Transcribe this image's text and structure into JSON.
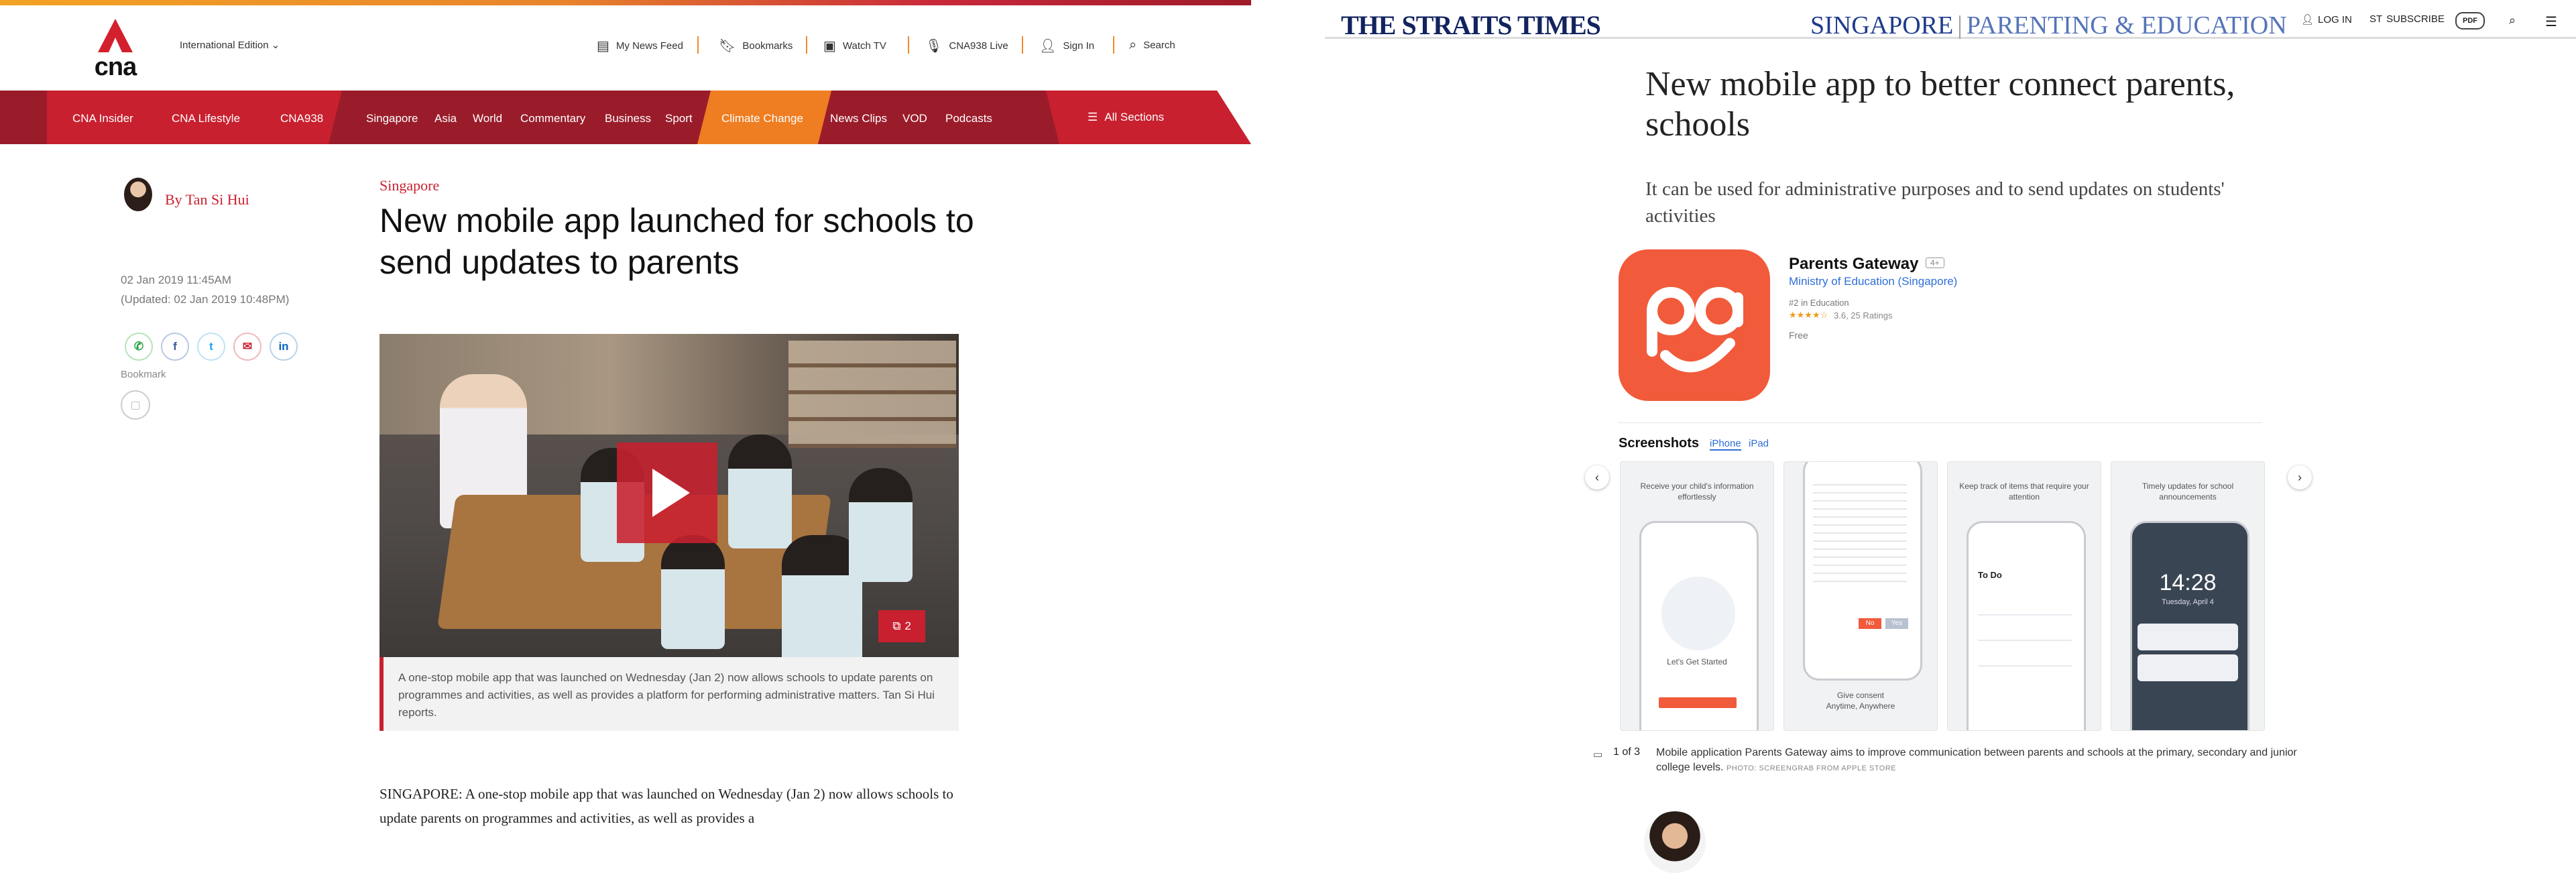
{
  "cna": {
    "logo_text": "cna",
    "edition": "International Edition",
    "utility": [
      {
        "label": "My News Feed",
        "icon": "newsfeed-icon"
      },
      {
        "label": "Bookmarks",
        "icon": "bookmark-icon"
      },
      {
        "label": "Watch TV",
        "icon": "tv-icon"
      },
      {
        "label": "CNA938 Live",
        "icon": "microphone-icon"
      },
      {
        "label": "Sign In",
        "icon": "user-icon"
      },
      {
        "label": "Search",
        "icon": "search-icon"
      }
    ],
    "nav": [
      "CNA Insider",
      "CNA Lifestyle",
      "CNA938",
      "Singapore",
      "Asia",
      "World",
      "Commentary",
      "Business",
      "Sport",
      "Climate Change",
      "News Clips",
      "VOD",
      "Podcasts"
    ],
    "all_sections": "All Sections",
    "author": "By Tan Si Hui",
    "date_published": "02 Jan 2019 11:45AM",
    "date_updated": "(Updated: 02 Jan 2019 10:48PM)",
    "share": [
      "whatsapp",
      "facebook",
      "twitter",
      "email",
      "linkedin"
    ],
    "bookmark_label": "Bookmark",
    "category": "Singapore",
    "headline": "New mobile app launched for schools to send updates to parents",
    "video_count": "2",
    "caption": "A one-stop mobile app that was launched on Wednesday (Jan 2) now allows schools to update parents on programmes and activities, as well as provides a platform for performing administrative matters. Tan Si Hui reports.",
    "body": "SINGAPORE: A one-stop mobile app that was launched on Wednesday (Jan 2) now allows schools to update parents on programmes and activities, as well as provides a",
    "colors": {
      "brand_red": "#c8202f",
      "nav_dark": "#9a1c2b",
      "orange": "#ef7d22"
    }
  },
  "st": {
    "logo": "THE STRAITS TIMES",
    "section": "SINGAPORE",
    "subsection": "PARENTING & EDUCATION",
    "utility": [
      {
        "label": "LOG IN",
        "icon": "user-icon"
      },
      {
        "label": "SUBSCRIBE",
        "icon": "subscribe-icon"
      },
      {
        "label": "PDF",
        "icon": "pdf-icon"
      },
      {
        "label": "",
        "icon": "search-icon"
      },
      {
        "label": "",
        "icon": "menu-icon"
      }
    ],
    "headline": "New mobile app to better connect parents, schools",
    "standfirst": "It can be used for administrative purposes and to send updates on students' activities",
    "app": {
      "name": "Parents Gateway",
      "age": "4+",
      "developer": "Ministry of Education (Singapore)",
      "rank": "#2 in Education",
      "stars": "★★★★☆",
      "rating": "3.6, 25 Ratings",
      "price": "Free",
      "screenshots_title": "Screenshots",
      "tab_iphone": "iPhone",
      "tab_ipad": "iPad",
      "shot_headlines": [
        "Receive your child's information effortlessly",
        "Give consent Anytime, Anywhere",
        "Keep track of items that require your attention",
        "Timely updates for school announcements"
      ],
      "shot_texts": {
        "lets_get_started": "Let's Get Started",
        "to_do": "To Do",
        "clock": "14:28",
        "date": "Tuesday, April 4",
        "give_consent": "Give consent",
        "anytime": "Anytime, Anywhere",
        "consent_no": "No",
        "consent_yes": "Yes"
      }
    },
    "counter": "1 of 3",
    "caption": "Mobile application Parents Gateway aims to improve communication between parents and schools at the primary, secondary and junior college levels.",
    "credit": "PHOTO: SCREENGRAB FROM APPLE STORE",
    "colors": {
      "navy": "#12235f",
      "section_blue": "#1f3c8d",
      "app_orange": "#f15a3a",
      "link_blue": "#2e6fd6"
    }
  }
}
